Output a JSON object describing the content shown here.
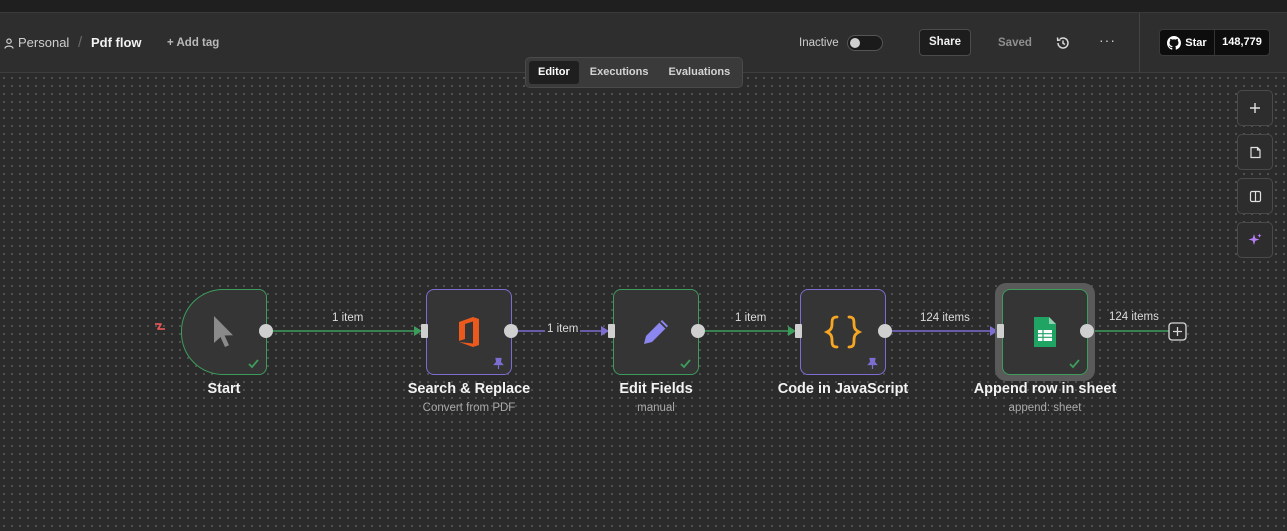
{
  "header": {
    "breadcrumb": {
      "project": "Personal",
      "separator": "/",
      "workflow": "Pdf flow"
    },
    "add_tag": "+ Add tag",
    "status_label": "Inactive",
    "share_label": "Share",
    "saved_label": "Saved",
    "more_label": "···",
    "github": {
      "star_label": "Star",
      "count": "148,779"
    }
  },
  "tabs": [
    {
      "label": "Editor",
      "active": true
    },
    {
      "label": "Executions",
      "active": false
    },
    {
      "label": "Evaluations",
      "active": false
    }
  ],
  "canvas_controls": [
    {
      "icon": "plus-icon"
    },
    {
      "icon": "sticky-note-icon"
    },
    {
      "icon": "panel-toggle-icon"
    },
    {
      "icon": "ai-sparkle-icon"
    }
  ],
  "nodes": [
    {
      "id": "start",
      "title": "Start",
      "subtitle": "",
      "icon": "cursor-icon",
      "status": "success"
    },
    {
      "id": "search",
      "title": "Search & Replace",
      "subtitle": "Convert from PDF",
      "icon": "office-icon",
      "status": "pinned"
    },
    {
      "id": "edit",
      "title": "Edit Fields",
      "subtitle": "manual",
      "icon": "pencil-icon",
      "status": "success"
    },
    {
      "id": "code",
      "title": "Code in JavaScript",
      "subtitle": "",
      "icon": "curly-braces-icon",
      "status": "pinned"
    },
    {
      "id": "sheet",
      "title": "Append row in sheet",
      "subtitle": "append: sheet",
      "icon": "google-sheets-icon",
      "status": "success"
    }
  ],
  "connections": [
    {
      "label": "1 item"
    },
    {
      "label": "1 item"
    },
    {
      "label": "1 item"
    },
    {
      "label": "124 items"
    },
    {
      "label": "124 items"
    }
  ],
  "colors": {
    "success": "#3d9c5c",
    "pinned": "#7b6ed0",
    "trigger": "#e05656",
    "accent_orange": "#f5a623"
  }
}
